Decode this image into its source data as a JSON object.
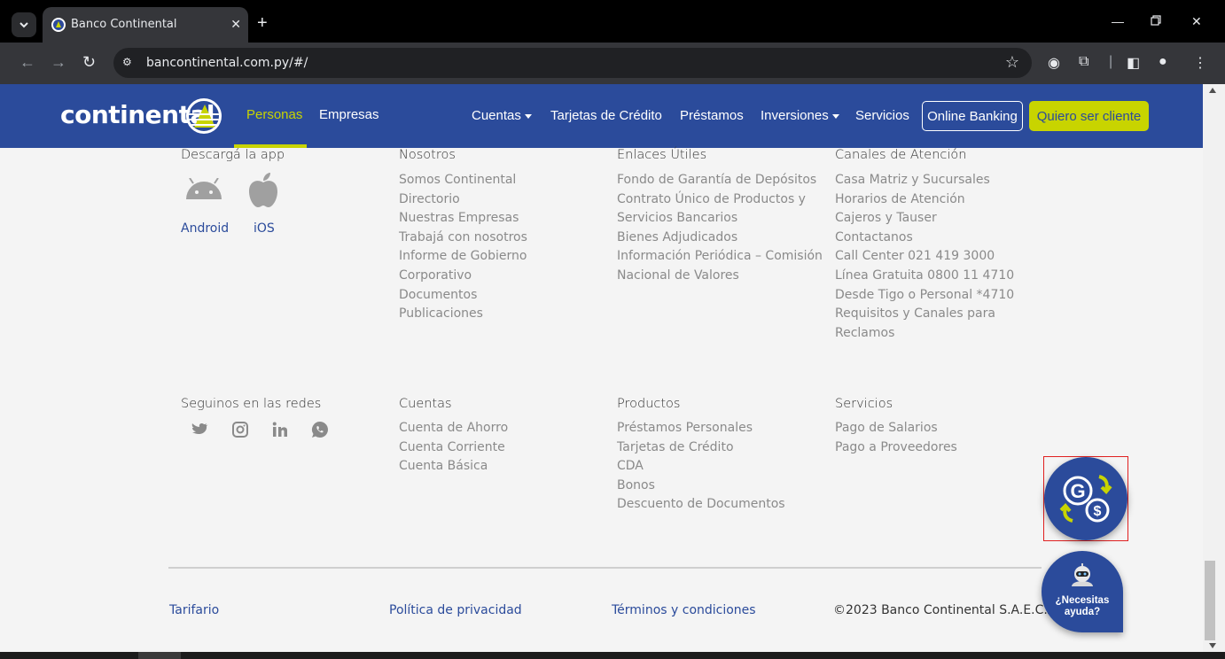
{
  "browser": {
    "tab_title": "Banco Continental",
    "url": "bancontinental.com.py/#/"
  },
  "navbar": {
    "logo_text": "continental",
    "sections": [
      {
        "label": "Personas",
        "active": true
      },
      {
        "label": "Empresas",
        "active": false
      }
    ],
    "menu": [
      "Cuentas",
      "Tarjetas de Crédito",
      "Préstamos",
      "Inversiones",
      "Servicios"
    ],
    "online_banking": "Online Banking",
    "quiero_cliente": "Quiero ser cliente",
    "colors": {
      "brand": "#2b4b9b",
      "accent": "#c8d400"
    }
  },
  "footer": {
    "app": {
      "title": "Descargá la app",
      "android": "Android",
      "ios": "iOS"
    },
    "nosotros": {
      "title": "Nosotros",
      "items": [
        "Somos Continental",
        "Directorio",
        "Nuestras Empresas",
        "Trabajá con nosotros",
        "Informe de Gobierno",
        "Corporativo",
        "Documentos",
        "Publicaciones"
      ]
    },
    "enlaces": {
      "title": "Enlaces Útiles",
      "items": [
        "Fondo de Garantía de Depósitos",
        "Contrato Único de Productos y",
        "Servicios Bancarios",
        "Bienes Adjudicados",
        "Información Periódica – Comisión",
        "Nacional de Valores"
      ]
    },
    "canales": {
      "title": "Canales de Atención",
      "items": [
        "Casa Matriz y Sucursales",
        "Horarios de Atención",
        "Cajeros y Tauser",
        "Contactanos",
        "Call Center 021 419 3000",
        "Línea Gratuita 0800 11 4710",
        "Desde Tigo o Personal *4710",
        "Requisitos y Canales para",
        "Reclamos"
      ]
    },
    "redes": {
      "title": "Seguinos en las redes",
      "icons": [
        "twitter-icon",
        "instagram-icon",
        "linkedin-icon",
        "whatsapp-icon"
      ]
    },
    "cuentas": {
      "title": "Cuentas",
      "items": [
        "Cuenta de Ahorro",
        "Cuenta Corriente",
        "Cuenta Básica"
      ]
    },
    "productos": {
      "title": "Productos",
      "items": [
        "Préstamos Personales",
        "Tarjetas de Crédito",
        "CDA",
        "Bonos",
        "Descuento de Documentos"
      ]
    },
    "servicios": {
      "title": "Servicios",
      "items": [
        "Pago de Salarios",
        "Pago a Proveedores"
      ]
    },
    "bottom": {
      "tarifario": "Tarifario",
      "privacidad": "Política de privacidad",
      "terminos": "Términos y condiciones",
      "copyright": "©2023 Banco Continental S.A.E.C.A"
    }
  },
  "widgets": {
    "exchange_icon": "currency-exchange-icon",
    "help_text_1": "¿Necesitas",
    "help_text_2": "ayuda?"
  }
}
